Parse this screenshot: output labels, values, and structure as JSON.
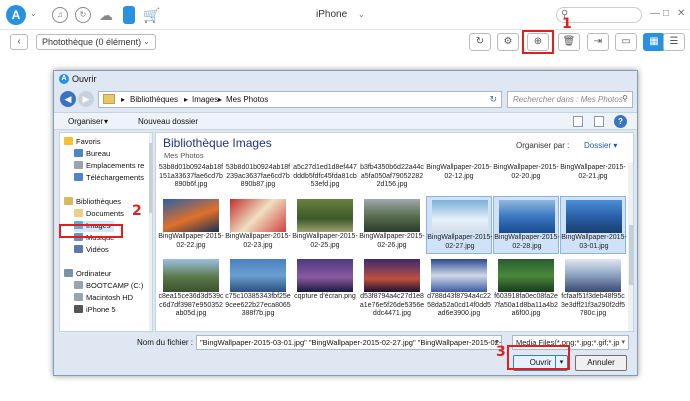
{
  "app": {
    "logo_letter": "A",
    "device_title": "iPhone",
    "search_icon": "search-icon"
  },
  "toolbar": {
    "album_select": "Photothèque (0 élément)"
  },
  "callouts": [
    "1",
    "2",
    "3"
  ],
  "dialog": {
    "title": "Ouvrir",
    "breadcrumb": [
      "Bibliothèques",
      "Images",
      "Mes Photos"
    ],
    "search_placeholder": "Rechercher dans : Mes Photos",
    "commands": {
      "organize": "Organiser",
      "new_folder": "Nouveau dossier"
    },
    "nav": {
      "favorites": "Favoris",
      "desktop": "Bureau",
      "recent": "Emplacements re",
      "downloads": "Téléchargements",
      "libraries": "Bibliothèques",
      "documents": "Documents",
      "images": "Images",
      "music": "Musique",
      "videos": "Vidéos",
      "computer": "Ordinateur",
      "bootcamp": "BOOTCAMP (C:)",
      "macintosh": "Macintosh HD",
      "iphone": "iPhone 5"
    },
    "library": {
      "title": "Bibliothèque Images",
      "subtitle": "Mes Photos",
      "arrange_label": "Organiser par :",
      "arrange_value": "Dossier"
    },
    "files_row0": [
      "53b8d01b0924ab18f151a33637fae6cd7b890b6f.jpg",
      "53b8d01b0924ab18f239ac3637fae6cd7b890b87.jpg",
      "a5c27d1ed1d8ef447dddb5fdfc45fda81cb53efd.jpg",
      "b3fb4350b6d22a44ca5fa050af790522822d156.jpg",
      "BingWallpaper-2015-02-12.jpg",
      "BingWallpaper-2015-02-20.jpg",
      "BingWallpaper-2015-02-21.jpg"
    ],
    "files_row1": [
      "BingWallpaper-2015-02-22.jpg",
      "BingWallpaper-2015-02-23.jpg",
      "BingWallpaper-2015-02-25.jpg",
      "BingWallpaper-2015-02-26.jpg",
      "BingWallpaper-2015-02-27.jpg",
      "BingWallpaper-2015-02-28.jpg",
      "BingWallpaper-2015-03-01.jpg"
    ],
    "files_row2": [
      "c8ea15ce36d3d539cc6d7df3987e950352ab05d.jpg",
      "c75c10385343fbf25e9cee622b27eca8065388f7b.jpg",
      "cqpture d'écran.png",
      "d53f8794a4c27d1e8a1e76e5f26de5356eddc4471.jpg",
      "d788d43f8794a4c2258da52a0cd14f0dd5ad6e3900.jpg",
      "f603918fa0ec08fa2e7fa50a1d8ba11a4b2a6f00.jpg",
      "fcfaaf51f3deb48f95c3e3dff21f3a290f2df5780c.jpg"
    ],
    "filename_label": "Nom du fichier :",
    "filename_value": "\"BingWallpaper-2015-03-01.jpg\" \"BingWallpaper-2015-02-27.jpg\" \"BingWallpaper-2015-02-",
    "filetype_value": "Media Files(*.png;*.jpg;*.gif;*.jp",
    "open_button": "Ouvrir",
    "cancel_button": "Annuler"
  },
  "colors": {
    "accent": "#2a90e0",
    "callout": "#e02020",
    "lib_title": "#1e3287"
  }
}
